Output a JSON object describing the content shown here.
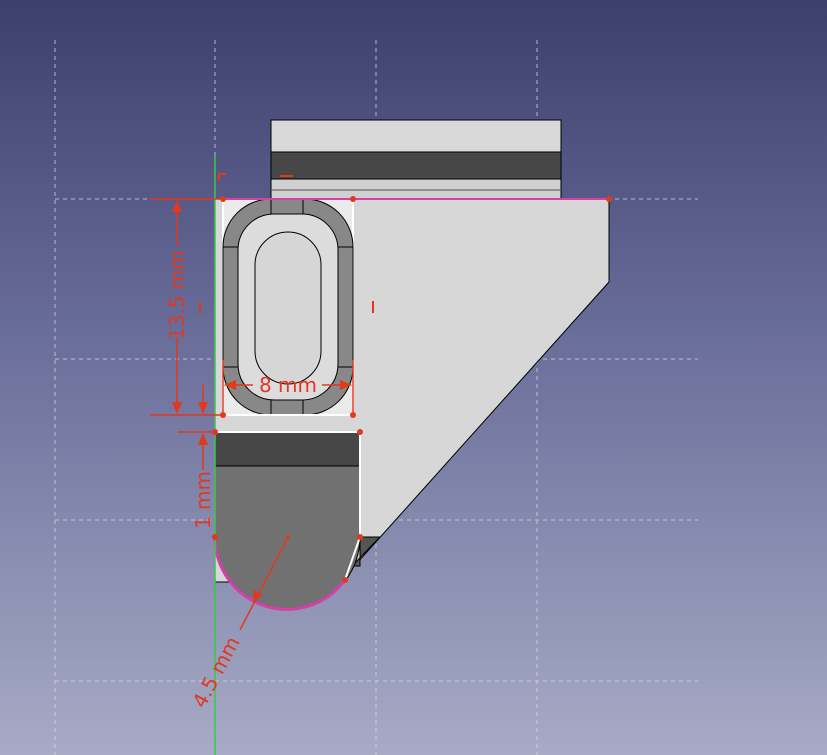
{
  "view": {
    "background_top": "#3d3e6c",
    "background_bottom": "#a7abc6",
    "grid_color": "#d8d8e8",
    "constraint_color": "#e0391f",
    "selection_color": "#d63fa6",
    "axis_color": "#3ac84a"
  },
  "dimensions": {
    "height_label": "13.5 mm",
    "width_label": "8 mm",
    "gap_label": "1 mm",
    "radius_label": "4.5 mm"
  },
  "icons": [
    "coincident-constraint-icon",
    "horizontal-constraint-icon",
    "vertical-constraint-icon"
  ]
}
